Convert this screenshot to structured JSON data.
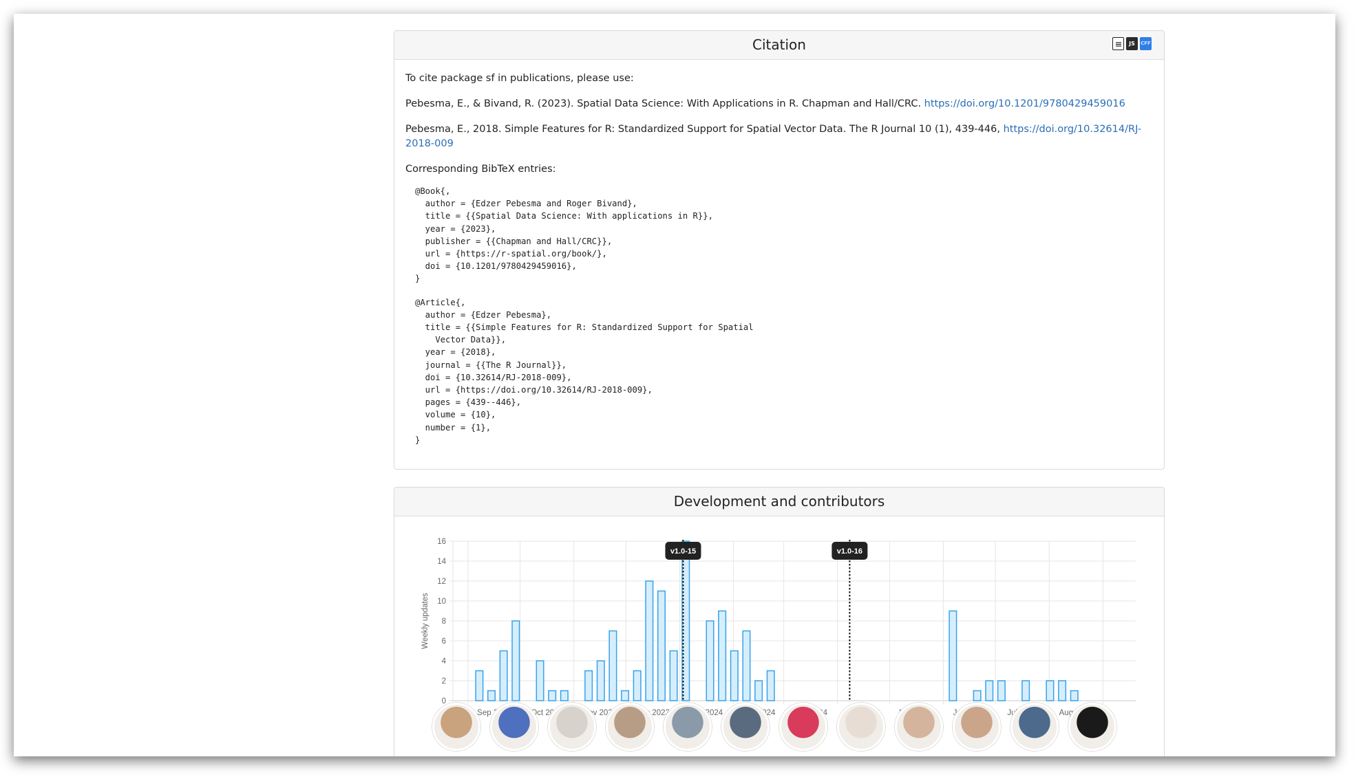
{
  "citation": {
    "title": "Citation",
    "icons": [
      "document-icon",
      "json-icon",
      "cff-icon"
    ],
    "icon_labels": {
      "json": "JS",
      "cff": "CFF"
    },
    "intro": "To cite package sf in publications, please use:",
    "ref1_text": "Pebesma, E., & Bivand, R. (2023). Spatial Data Science: With Applications in R. Chapman and Hall/CRC. ",
    "ref1_link": "https://doi.org/10.1201/9780429459016",
    "ref2_text": "Pebesma, E., 2018. Simple Features for R: Standardized Support for Spatial Vector Data. The R Journal 10 (1), 439-446, ",
    "ref2_link": "https://doi.org/10.32614/RJ-2018-009",
    "bibtex_heading": "Corresponding BibTeX entries:",
    "bibtex_book": "@Book{,\n  author = {Edzer Pebesma and Roger Bivand},\n  title = {{Spatial Data Science: With applications in R}},\n  year = {2023},\n  publisher = {{Chapman and Hall/CRC}},\n  url = {https://r-spatial.org/book/},\n  doi = {10.1201/9780429459016},\n}",
    "bibtex_article": "@Article{,\n  author = {Edzer Pebesma},\n  title = {{Simple Features for R: Standardized Support for Spatial\n    Vector Data}},\n  year = {2018},\n  journal = {{The R Journal}},\n  doi = {10.32614/RJ-2018-009},\n  url = {https://doi.org/10.32614/RJ-2018-009},\n  pages = {439--446},\n  volume = {10},\n  number = {1},\n}"
  },
  "development": {
    "title": "Development and contributors",
    "avatar_count": 12
  },
  "colors": {
    "bar_fill": "#d6eefb",
    "bar_stroke": "#36a2eb",
    "link": "#2a6db5",
    "release_label_bg": "#222222"
  },
  "chart_data": {
    "type": "bar",
    "ylabel": "Weekly updates",
    "xlabel": "",
    "ylim": [
      0,
      16
    ],
    "yticks": [
      0,
      2,
      4,
      6,
      8,
      10,
      12,
      14,
      16
    ],
    "grid": true,
    "x_tick_labels": [
      "Sep 2023",
      "Oct 2023",
      "Nov 2023",
      "Dec 2023",
      "Jan 2024",
      "Feb 2024",
      "Mar 2024",
      "Apr 2024",
      "May 2024",
      "Jun 2024",
      "Jul 2024",
      "Aug 2024"
    ],
    "weeks": [
      "2023-09-04",
      "2023-09-11",
      "2023-09-18",
      "2023-09-25",
      "2023-10-02",
      "2023-10-09",
      "2023-10-16",
      "2023-10-23",
      "2023-10-30",
      "2023-11-06",
      "2023-11-13",
      "2023-11-20",
      "2023-11-27",
      "2023-12-04",
      "2023-12-11",
      "2023-12-18",
      "2023-12-25",
      "2024-01-01",
      "2024-01-08",
      "2024-01-15",
      "2024-01-22",
      "2024-01-29",
      "2024-02-05",
      "2024-02-12",
      "2024-02-19",
      "2024-02-26",
      "2024-03-04",
      "2024-03-11",
      "2024-03-18",
      "2024-03-25",
      "2024-04-01",
      "2024-04-08",
      "2024-04-15",
      "2024-04-22",
      "2024-04-29",
      "2024-05-06",
      "2024-05-13",
      "2024-05-20",
      "2024-05-27",
      "2024-06-03",
      "2024-06-10",
      "2024-06-17",
      "2024-06-24",
      "2024-07-01",
      "2024-07-08",
      "2024-07-15",
      "2024-07-22",
      "2024-07-29",
      "2024-08-05",
      "2024-08-12"
    ],
    "values": [
      3,
      1,
      5,
      8,
      0,
      4,
      1,
      1,
      0,
      3,
      4,
      7,
      1,
      3,
      12,
      11,
      5,
      16,
      0,
      8,
      9,
      5,
      7,
      2,
      3,
      0,
      0,
      0,
      0,
      0,
      0,
      0,
      0,
      0,
      0,
      0,
      0,
      0,
      0,
      9,
      0,
      1,
      2,
      2,
      0,
      2,
      0,
      2,
      2,
      1
    ],
    "releases": [
      {
        "label": "v1.0-15",
        "date": "2024-01-03"
      },
      {
        "label": "v1.0-16",
        "date": "2024-04-08"
      }
    ]
  }
}
